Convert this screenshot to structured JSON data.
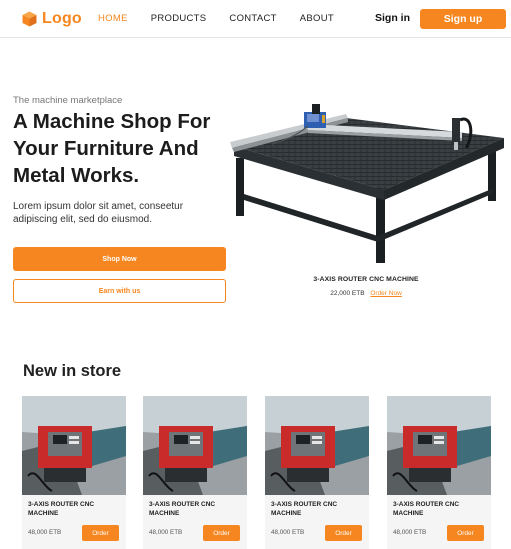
{
  "header": {
    "logo_text": "Logo",
    "nav": [
      {
        "label": "HOME",
        "active": true
      },
      {
        "label": "PRODUCTS",
        "active": false
      },
      {
        "label": "CONTACT",
        "active": false
      },
      {
        "label": "ABOUT",
        "active": false
      }
    ],
    "signin_label": "Sign in",
    "signup_label": "Sign up"
  },
  "hero": {
    "eyebrow": "The machine marketplace",
    "title": "A Machine Shop For Your Furniture And Metal Works.",
    "description": "Lorem ipsum dolor sit amet, conseetur adipiscing elit, sed do eiusmod.",
    "shop_label": "Shop Now",
    "earn_label": "Earn with us",
    "featured": {
      "name": "3-AXIS ROUTER CNC MACHINE",
      "price": "22,000 ETB",
      "order_label": "Order Now"
    }
  },
  "store": {
    "title": "New in store",
    "products": [
      {
        "name": "3-AXIS ROUTER CNC MACHINE",
        "price": "48,000 ETB",
        "order_label": "Order"
      },
      {
        "name": "3-AXIS ROUTER CNC MACHINE",
        "price": "48,000 ETB",
        "order_label": "Order"
      },
      {
        "name": "3-AXIS ROUTER CNC MACHINE",
        "price": "48,000 ETB",
        "order_label": "Order"
      },
      {
        "name": "3-AXIS ROUTER CNC MACHINE",
        "price": "48,000 ETB",
        "order_label": "Order"
      }
    ]
  },
  "colors": {
    "accent": "#f6861f",
    "text": "#1c1c1c",
    "card_bg": "#f5f5f5"
  },
  "icons": {
    "logo": "cube-icon"
  }
}
